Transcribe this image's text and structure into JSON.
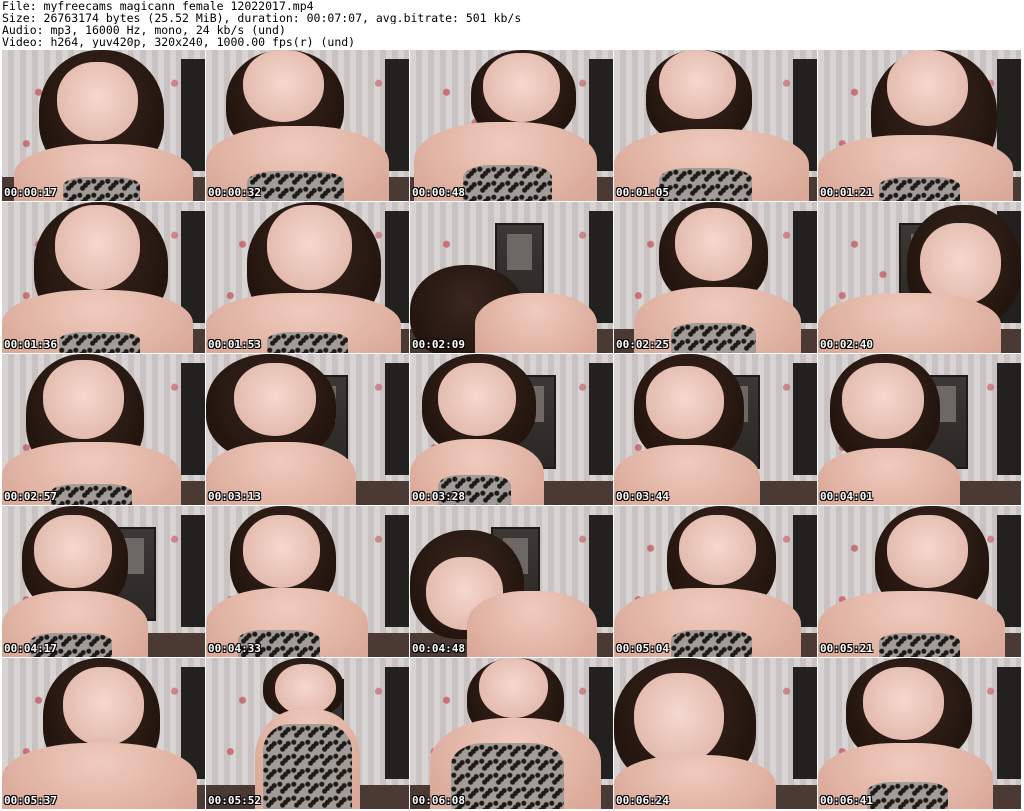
{
  "header": {
    "file_line": "File: myfreecams_magicann_female_12022017.mp4",
    "size_line": "Size: 26763174 bytes (25.52 MiB), duration: 00:07:07, avg.bitrate: 501 kb/s",
    "audio_line": "Audio: mp3, 16000 Hz, mono, 24 kb/s (und)",
    "video_line": "Video: h264, yuv420p, 320x240, 1000.00 fps(r) (und)"
  },
  "thumbnails": [
    {
      "timestamp": "00:00:17"
    },
    {
      "timestamp": "00:00:32"
    },
    {
      "timestamp": "00:00:48"
    },
    {
      "timestamp": "00:01:05"
    },
    {
      "timestamp": "00:01:21"
    },
    {
      "timestamp": "00:01:36"
    },
    {
      "timestamp": "00:01:53"
    },
    {
      "timestamp": "00:02:09"
    },
    {
      "timestamp": "00:02:25"
    },
    {
      "timestamp": "00:02:40"
    },
    {
      "timestamp": "00:02:57"
    },
    {
      "timestamp": "00:03:13"
    },
    {
      "timestamp": "00:03:28"
    },
    {
      "timestamp": "00:03:44"
    },
    {
      "timestamp": "00:04:01"
    },
    {
      "timestamp": "00:04:17"
    },
    {
      "timestamp": "00:04:33"
    },
    {
      "timestamp": "00:04:48"
    },
    {
      "timestamp": "00:05:04"
    },
    {
      "timestamp": "00:05:21"
    },
    {
      "timestamp": "00:05:37"
    },
    {
      "timestamp": "00:05:52"
    },
    {
      "timestamp": "00:06:08"
    },
    {
      "timestamp": "00:06:24"
    },
    {
      "timestamp": "00:06:41"
    }
  ]
}
